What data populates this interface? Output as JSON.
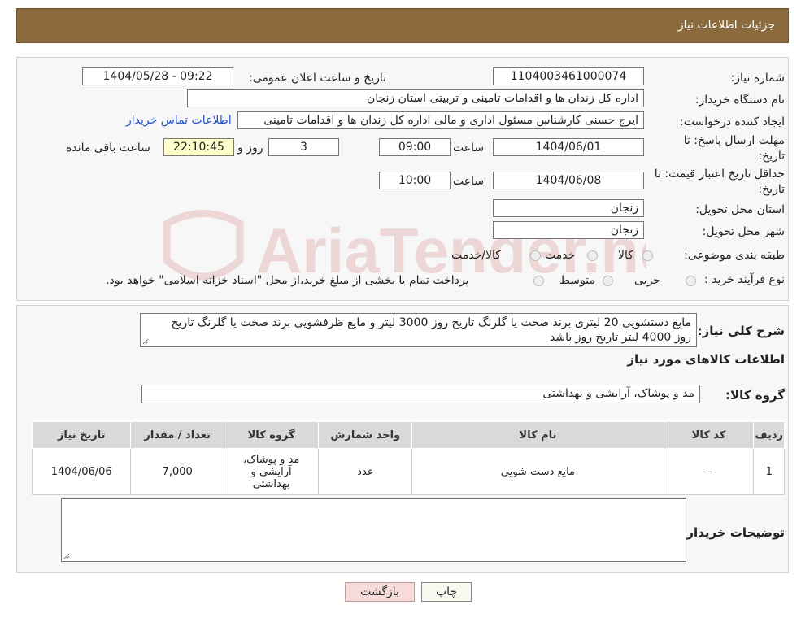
{
  "header": {
    "title": "جزئیات اطلاعات نیاز"
  },
  "form": {
    "need_number_label": "شماره نیاز:",
    "need_number": "1104003461000074",
    "announce_label": "تاریخ و ساعت اعلان عمومی:",
    "announce_value": "1404/05/28 - 09:22",
    "buyer_label": "نام دستگاه خریدار:",
    "buyer": "اداره کل زندان ها و اقدامات تامینی و تربیتی استان زنجان",
    "creator_label": "ایجاد کننده درخواست:",
    "creator": "ایرج حسنی کارشناس مسئول اداری و مالی اداره کل زندان ها و اقدامات تامینی",
    "contact_link": "اطلاعات تماس خریدار",
    "deadline_label_1": "مهلت ارسال پاسخ: تا",
    "deadline_label_2": "تاریخ:",
    "deadline_date": "1404/06/01",
    "time_label": "ساعت",
    "deadline_time": "09:00",
    "days": "3",
    "days_label": "روز و",
    "remaining": "22:10:45",
    "remaining_label": "ساعت باقی مانده",
    "validity_label_1": "حداقل تاریخ اعتبار قیمت: تا",
    "validity_label_2": "تاریخ:",
    "validity_date": "1404/06/08",
    "validity_time": "10:00",
    "province_label": "استان محل تحویل:",
    "province": "زنجان",
    "city_label": "شهر محل تحویل:",
    "city": "زنجان",
    "category_label": "طبقه بندی موضوعی:",
    "category_options": [
      "کالا",
      "خدمت",
      "کالا/خدمت"
    ],
    "process_label": "نوع فرآیند خرید :",
    "process_options": [
      "جزیی",
      "متوسط"
    ],
    "process_note": "پرداخت تمام یا بخشی از مبلغ خرید،از محل \"اسناد خزانه اسلامی\" خواهد بود."
  },
  "watermark": {
    "text": "AriaTender.neT"
  },
  "details": {
    "desc_label": "شرح کلی نیاز:",
    "desc_line1": "مایع دستشویی 20 لیتری برند صحت یا گلرنگ تاریخ روز 3000 لیتر و مایع ظرفشویی برند صحت یا گلرنگ تاریخ",
    "desc_line2": "روز 4000 لیتر تاریخ روز باشد",
    "goods_info_title": "اطلاعات کالاهای مورد نیاز",
    "group_label": "گروه کالا:",
    "group_value": "مد و پوشاک، آرایشی و بهداشتی",
    "buyer_notes_label": "توضیحات خریدار:"
  },
  "table": {
    "headers": [
      "ردیف",
      "کد کالا",
      "نام کالا",
      "واحد شمارش",
      "گروه کالا",
      "تعداد / مقدار",
      "تاریخ نیاز"
    ],
    "rows": [
      {
        "index": "1",
        "code": "--",
        "name": "مایع دست شویی",
        "unit": "عدد",
        "group_1": "مد و پوشاک،",
        "group_2": "آرایشی و",
        "group_3": "بهداشتی",
        "qty": "7,000",
        "date": "1404/06/06"
      }
    ]
  },
  "buttons": {
    "print": "چاپ",
    "back": "بازگشت"
  }
}
